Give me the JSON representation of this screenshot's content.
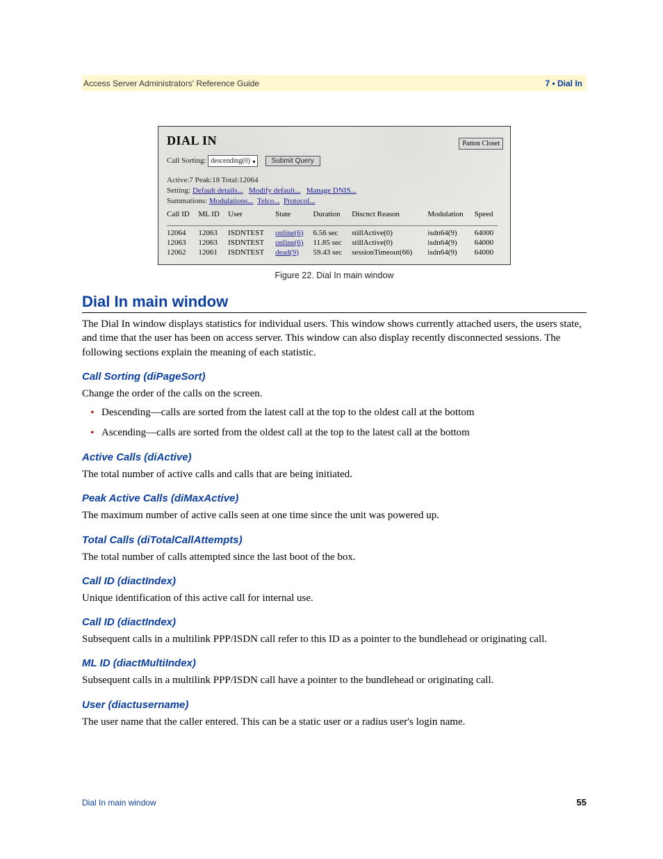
{
  "header": {
    "left": "Access Server Administrators' Reference Guide",
    "right": "7 • Dial In"
  },
  "screenshot": {
    "title": "DIAL IN",
    "sort_label": "Call Sorting:",
    "sort_value": "descending(0)",
    "submit_label": "Submit Query",
    "patton_label": "Patton Closet",
    "status_line": "Active:7 Peak:18 Total:12064",
    "setting_prefix": "Setting:",
    "setting_links": [
      "Default details...",
      "Modify default...",
      "Manage DNIS..."
    ],
    "summations_prefix": "Summations:",
    "summations_links": [
      "Modulations...",
      "Telco...",
      "Protocol..."
    ],
    "columns": [
      "Call ID",
      "ML ID",
      "User",
      "State",
      "Duration",
      "Discnct Reason",
      "Modulation",
      "Speed"
    ],
    "rows": [
      {
        "call_id": "12064",
        "ml_id": "12063",
        "user": "ISDNTEST",
        "state": "online(6)",
        "duration": "6.56 sec",
        "reason": "stillActive(0)",
        "mod": "isdn64(9)",
        "speed": "64000"
      },
      {
        "call_id": "12063",
        "ml_id": "12063",
        "user": "ISDNTEST",
        "state": "online(6)",
        "duration": "11.85 sec",
        "reason": "stillActive(0)",
        "mod": "isdn64(9)",
        "speed": "64000"
      },
      {
        "call_id": "12062",
        "ml_id": "12061",
        "user": "ISDNTEST",
        "state": "dead(9)",
        "duration": "59.43 sec",
        "reason": "sessionTimeout(66)",
        "mod": "isdn64(9)",
        "speed": "64000"
      }
    ]
  },
  "figure_caption": "Figure 22. Dial In main window",
  "h1": "Dial In main window",
  "intro": "The Dial In window displays statistics for individual users. This window shows currently attached users, the users state, and time that the user has been on access server. This window can also display recently disconnected sessions. The following sections explain the meaning of each statistic.",
  "sections": {
    "call_sorting": {
      "title": "Call Sorting (diPageSort)",
      "text": "Change the order of the calls on the screen.",
      "bullets": [
        "Descending—calls are sorted from the latest call at the top to the oldest call at the bottom",
        "Ascending—calls are sorted from the oldest call at the top to the latest call at the bottom"
      ]
    },
    "active_calls": {
      "title": "Active Calls (diActive)",
      "text": "The total number of active calls and calls that are being initiated."
    },
    "peak_active": {
      "title": "Peak Active Calls (diMaxActive)",
      "text": "The maximum number of active calls seen at one time since the unit was powered up."
    },
    "total_calls": {
      "title": "Total Calls (diTotalCallAttempts)",
      "text": "The total number of calls attempted since the last boot of the box."
    },
    "call_id_1": {
      "title": "Call ID (diactIndex)",
      "text": "Unique identification of this active call for internal use."
    },
    "call_id_2": {
      "title": "Call ID (diactIndex)",
      "text": "Subsequent calls in a multilink PPP/ISDN call refer to this ID as a pointer to the bundlehead or originating call."
    },
    "ml_id": {
      "title": "ML ID (diactMultiIndex)",
      "text": "Subsequent calls in a multilink PPP/ISDN call have a pointer to the bundlehead or originating call."
    },
    "user": {
      "title": "User (diactusername)",
      "text": "The user name that the caller entered. This can be a static user or a radius user's login name."
    }
  },
  "footer": {
    "left": "Dial In main window",
    "page": "55"
  }
}
